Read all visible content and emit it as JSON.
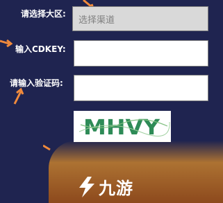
{
  "form": {
    "region": {
      "label": "请选择大区:",
      "placeholder": "选择渠道"
    },
    "cdkey": {
      "label": "输入CDKEY:",
      "value": ""
    },
    "captcha": {
      "label": "请输入验证码:",
      "value": "",
      "image_text": "MHVY"
    }
  },
  "watermark": {
    "text": "九游"
  },
  "colors": {
    "background": "#1f2450",
    "arrow": "#f08a3c",
    "captcha_text": "#2e8b57"
  }
}
